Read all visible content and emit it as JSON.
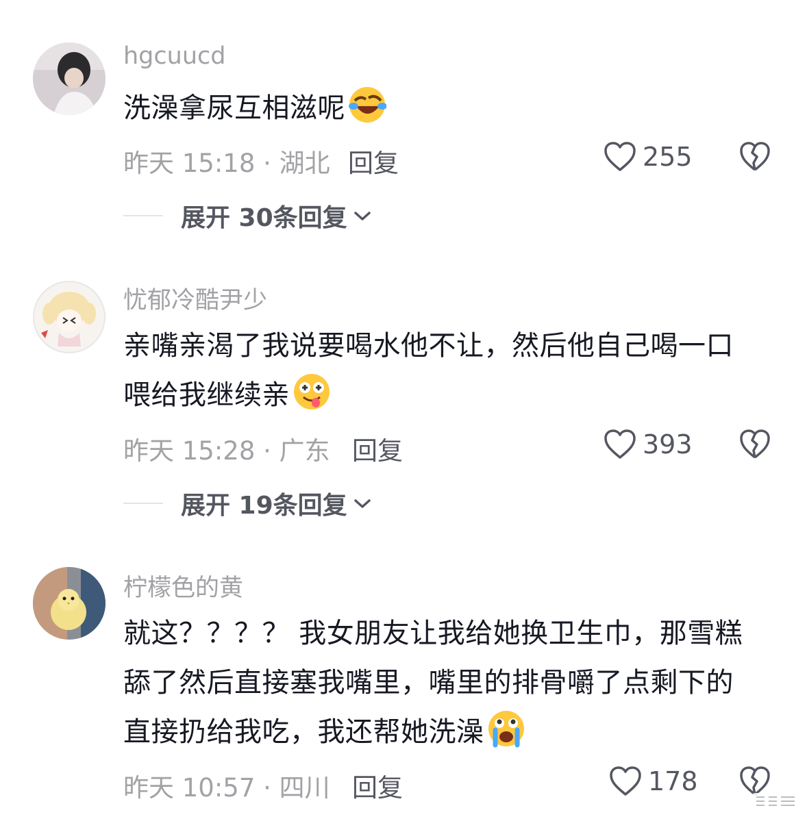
{
  "colors": {
    "text_primary": "#161823",
    "text_secondary": "#a2a2a6",
    "text_action": "#545660",
    "background": "#ffffff"
  },
  "comments": [
    {
      "username": "hgcuucd",
      "text": "洗澡拿尿互相滋呢",
      "emoji": "laughing-tears-emoji",
      "meta": "昨天 15:18 · 湖北",
      "reply_label": "回复",
      "likes": "255",
      "expand_label": "展开 30条回复"
    },
    {
      "username": "忧郁冷酷尹少",
      "text": "亲嘴亲渴了我说要喝水他不让，然后他自己喝一口喂给我继续亲",
      "emoji": "dizzy-tongue-emoji",
      "meta": "昨天 15:28 · 广东",
      "reply_label": "回复",
      "likes": "393",
      "expand_label": "展开 19条回复"
    },
    {
      "username": "柠檬色的黄",
      "text": "就这？？？？ 我女朋友让我给她换卫生巾，那雪糕舔了然后直接塞我嘴里，嘴里的排骨嚼了点剩下的直接扔给我吃，我还帮她洗澡",
      "emoji": "crying-emoji",
      "meta": "昨天 10:57 · 四川",
      "reply_label": "回复",
      "likes": "178"
    }
  ]
}
